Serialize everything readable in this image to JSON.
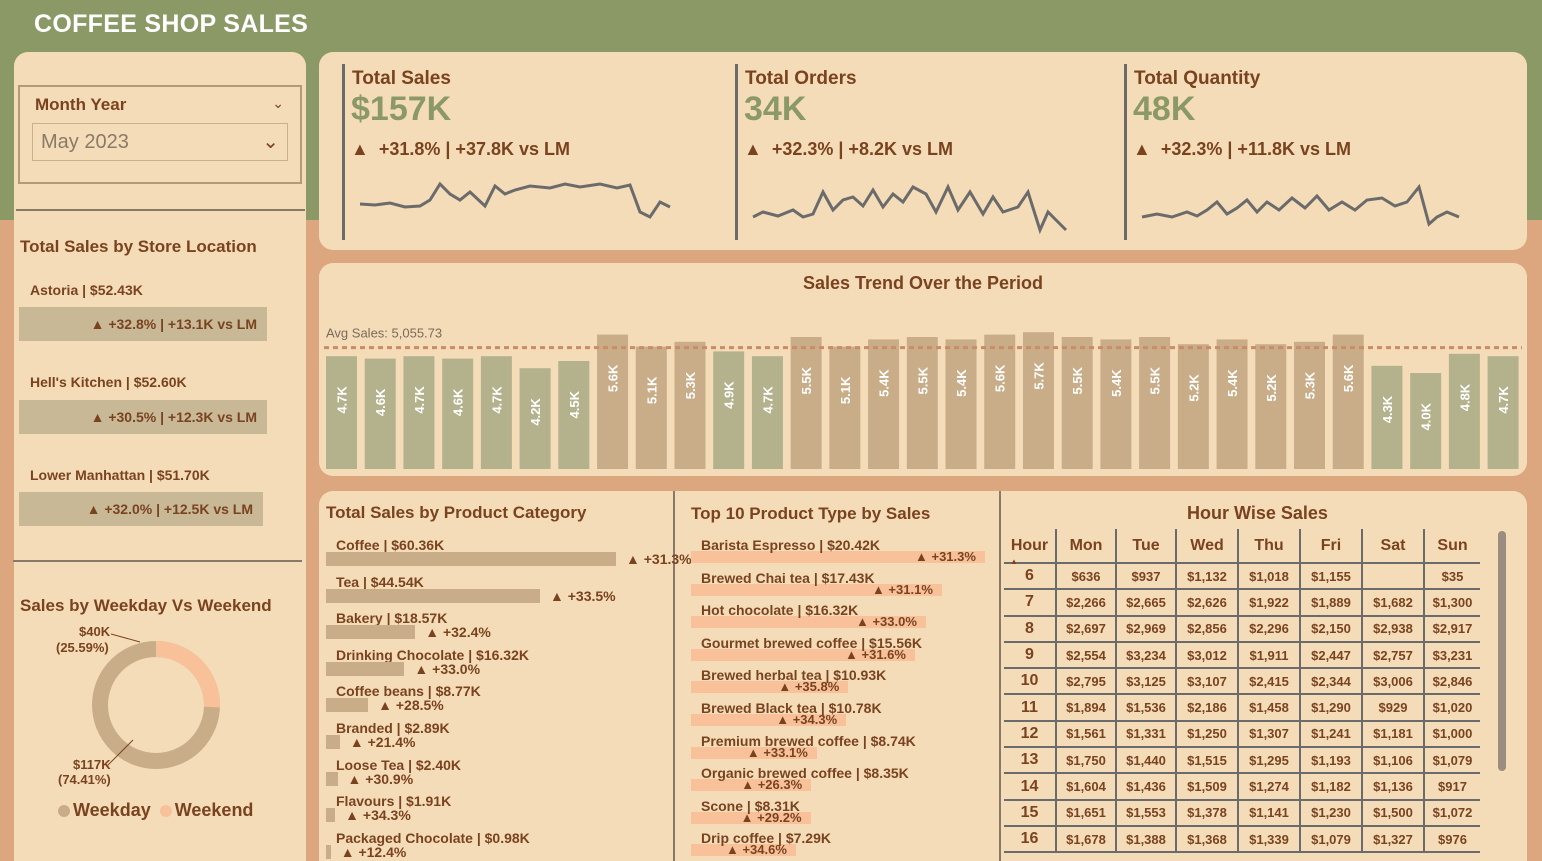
{
  "title": "COFFEE SHOP SALES",
  "slicer": {
    "label": "Month Year",
    "value": "May 2023"
  },
  "kpis": [
    {
      "label": "Total Sales",
      "value": "$157K",
      "delta": "+31.8% | +37.8K vs LM"
    },
    {
      "label": "Total Orders",
      "value": "34K",
      "delta": "+32.3% | +8.2K vs LM"
    },
    {
      "label": "Total Quantity",
      "value": "48K",
      "delta": "+32.3% | +11.8K vs LM"
    }
  ],
  "store": {
    "title": "Total Sales by Store Location",
    "items": [
      {
        "name": "Astoria | $52.43K",
        "delta": "+32.8% | +13.1K vs LM"
      },
      {
        "name": "Hell's Kitchen | $52.60K",
        "delta": "+30.5% | +12.3K vs LM"
      },
      {
        "name": "Lower Manhattan | $51.70K",
        "delta": "+32.0% | +12.5K vs LM"
      }
    ]
  },
  "weekday": {
    "title": "Sales by Weekday Vs Weekend",
    "weekend_label": "$40K",
    "weekend_pct": "(25.59%)",
    "weekday_label": "$117K",
    "weekday_pct": "(74.41%)",
    "legend_weekday": "Weekday",
    "legend_weekend": "Weekend",
    "colors": {
      "weekday": "#c9ad88",
      "weekend": "#f9c19a"
    }
  },
  "chart_data": {
    "type": "bar",
    "title": "Sales Trend Over the Period",
    "avg_label": "Avg Sales: 5,055.73",
    "avg": 5055.73,
    "ylim": [
      0,
      6000
    ],
    "values": [
      4.7,
      4.6,
      4.7,
      4.6,
      4.7,
      4.2,
      4.5,
      5.6,
      5.1,
      5.3,
      4.9,
      4.7,
      5.5,
      5.1,
      5.4,
      5.5,
      5.4,
      5.6,
      5.7,
      5.5,
      5.4,
      5.5,
      5.2,
      5.4,
      5.2,
      5.3,
      5.6,
      4.3,
      4.0,
      4.8,
      4.7
    ],
    "labels": [
      "4.7K",
      "4.6K",
      "4.7K",
      "4.6K",
      "4.7K",
      "4.2K",
      "4.5K",
      "5.6K",
      "5.1K",
      "5.3K",
      "4.9K",
      "4.7K",
      "5.5K",
      "5.1K",
      "5.4K",
      "5.5K",
      "5.4K",
      "5.6K",
      "5.7K",
      "5.5K",
      "5.4K",
      "5.5K",
      "5.2K",
      "5.4K",
      "5.2K",
      "5.3K",
      "5.6K",
      "4.3K",
      "4.0K",
      "4.8K",
      "4.7K"
    ],
    "colors": {
      "below": "#b3b28d",
      "above": "#c9ad88",
      "avg_line": "#c98c66"
    }
  },
  "categories": {
    "title": "Total Sales by Product Category",
    "items": [
      {
        "label": "Coffee | $60.36K",
        "value": 60.36,
        "delta": "+31.3%"
      },
      {
        "label": "Tea | $44.54K",
        "value": 44.54,
        "delta": "+33.5%"
      },
      {
        "label": "Bakery | $18.57K",
        "value": 18.57,
        "delta": "+32.4%"
      },
      {
        "label": "Drinking Chocolate | $16.32K",
        "value": 16.32,
        "delta": "+33.0%"
      },
      {
        "label": "Coffee beans | $8.77K",
        "value": 8.77,
        "delta": "+28.5%"
      },
      {
        "label": "Branded | $2.89K",
        "value": 2.89,
        "delta": "+21.4%"
      },
      {
        "label": "Loose Tea | $2.40K",
        "value": 2.4,
        "delta": "+30.9%"
      },
      {
        "label": "Flavours | $1.91K",
        "value": 1.91,
        "delta": "+34.3%"
      },
      {
        "label": "Packaged Chocolate | $0.98K",
        "value": 0.98,
        "delta": "+12.4%"
      }
    ]
  },
  "top10": {
    "title": "Top 10 Product Type by Sales",
    "items": [
      {
        "label": "Barista Espresso | $20.42K",
        "value": 20.42,
        "delta": "+31.3%"
      },
      {
        "label": "Brewed Chai tea | $17.43K",
        "value": 17.43,
        "delta": "+31.1%"
      },
      {
        "label": "Hot chocolate | $16.32K",
        "value": 16.32,
        "delta": "+33.0%"
      },
      {
        "label": "Gourmet brewed coffee | $15.56K",
        "value": 15.56,
        "delta": "+31.6%"
      },
      {
        "label": "Brewed herbal tea | $10.93K",
        "value": 10.93,
        "delta": "+35.8%"
      },
      {
        "label": "Brewed Black tea | $10.78K",
        "value": 10.78,
        "delta": "+34.3%"
      },
      {
        "label": "Premium brewed coffee | $8.74K",
        "value": 8.74,
        "delta": "+33.1%"
      },
      {
        "label": "Organic brewed coffee | $8.35K",
        "value": 8.35,
        "delta": "+26.3%"
      },
      {
        "label": "Scone | $8.31K",
        "value": 8.31,
        "delta": "+29.2%"
      },
      {
        "label": "Drip coffee | $7.29K",
        "value": 7.29,
        "delta": "+34.6%"
      }
    ]
  },
  "hour": {
    "title": "Hour Wise Sales",
    "headers": [
      "Hour",
      "Mon",
      "Tue",
      "Wed",
      "Thu",
      "Fri",
      "Sat",
      "Sun"
    ],
    "rows": [
      [
        "6",
        "$636",
        "$937",
        "$1,132",
        "$1,018",
        "$1,155",
        "",
        "$35"
      ],
      [
        "7",
        "$2,266",
        "$2,665",
        "$2,626",
        "$1,922",
        "$1,889",
        "$1,682",
        "$1,300"
      ],
      [
        "8",
        "$2,697",
        "$2,969",
        "$2,856",
        "$2,296",
        "$2,150",
        "$2,938",
        "$2,917"
      ],
      [
        "9",
        "$2,554",
        "$3,234",
        "$3,012",
        "$1,911",
        "$2,447",
        "$2,757",
        "$3,231"
      ],
      [
        "10",
        "$2,795",
        "$3,125",
        "$3,107",
        "$2,415",
        "$2,344",
        "$3,006",
        "$2,846"
      ],
      [
        "11",
        "$1,894",
        "$1,536",
        "$2,186",
        "$1,458",
        "$1,290",
        "$929",
        "$1,020"
      ],
      [
        "12",
        "$1,561",
        "$1,331",
        "$1,250",
        "$1,307",
        "$1,241",
        "$1,181",
        "$1,000"
      ],
      [
        "13",
        "$1,750",
        "$1,440",
        "$1,515",
        "$1,295",
        "$1,193",
        "$1,106",
        "$1,079"
      ],
      [
        "14",
        "$1,604",
        "$1,436",
        "$1,509",
        "$1,274",
        "$1,182",
        "$1,136",
        "$917"
      ],
      [
        "15",
        "$1,651",
        "$1,553",
        "$1,378",
        "$1,141",
        "$1,230",
        "$1,500",
        "$1,072"
      ],
      [
        "16",
        "$1,678",
        "$1,388",
        "$1,368",
        "$1,339",
        "$1,079",
        "$1,327",
        "$976"
      ]
    ]
  }
}
